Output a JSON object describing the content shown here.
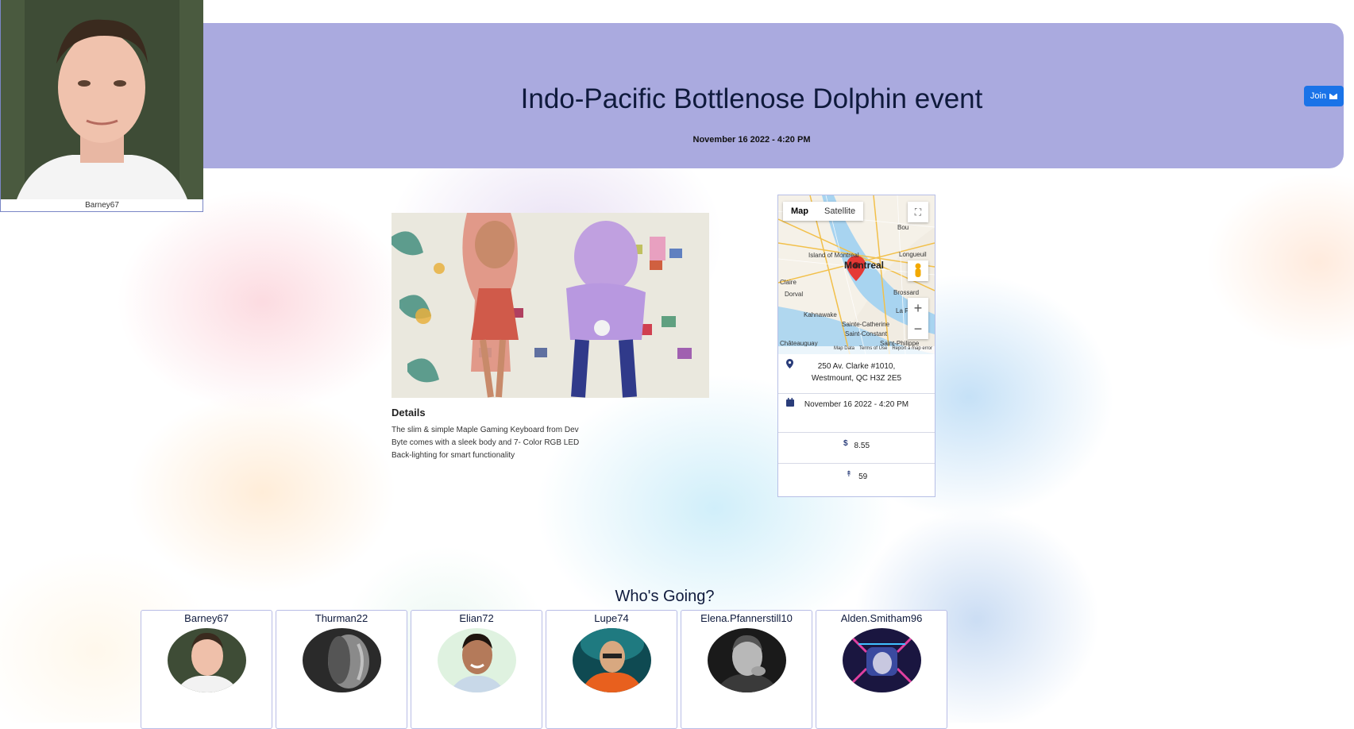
{
  "host": {
    "username": "Barney67"
  },
  "event": {
    "title": "Indo-Pacific Bottlenose Dolphin event",
    "datetime": "November 16 2022 - 4:20 PM",
    "join_label": "Join",
    "details_heading": "Details",
    "details_text": "The slim & simple Maple Gaming Keyboard from Dev Byte comes with a sleek body and 7- Color RGB LED Back-lighting for smart functionality"
  },
  "map": {
    "tabs": [
      "Map",
      "Satellite"
    ],
    "city_label": "Montreal",
    "labels": [
      "Island of Montreal",
      "Longueuil",
      "Dorval",
      "Brossard",
      "La Prairie",
      "Kahnawake",
      "Sainte-Catherine",
      "Saint-Constant",
      "Châteauguay",
      "Saint-Philippe",
      "Claire",
      "Bou"
    ],
    "footer": [
      "Map Data",
      "Terms of Use",
      "Report a map error"
    ],
    "zoom_in": "+",
    "zoom_out": "−",
    "fullscreen": "⛶"
  },
  "info": {
    "address_line1": "250 Av. Clarke #1010,",
    "address_line2": "Westmount, QC H3Z 2E5",
    "date": "November 16 2022 - 4:20 PM",
    "price_symbol": "$",
    "price": "8.55",
    "capacity_symbol": "↟",
    "capacity": "59"
  },
  "attendees": {
    "heading": "Who's Going?",
    "list": [
      {
        "name": "Barney67"
      },
      {
        "name": "Thurman22"
      },
      {
        "name": "Elian72"
      },
      {
        "name": "Lupe74"
      },
      {
        "name": "Elena.Pfannerstill10"
      },
      {
        "name": "Alden.Smitham96"
      }
    ]
  },
  "colors": {
    "hero_bg": "#aaaadf",
    "join_bg": "#1a73e8",
    "title_text": "#0f1a3c"
  }
}
